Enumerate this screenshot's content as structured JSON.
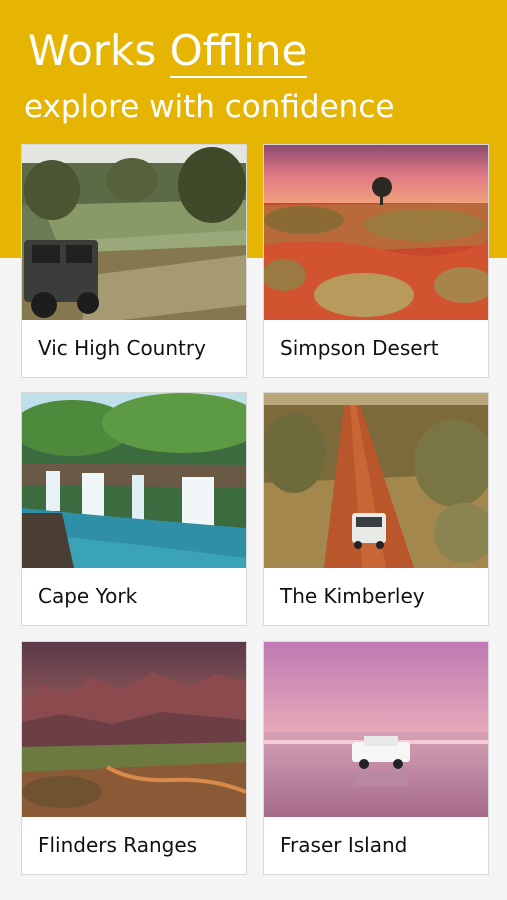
{
  "header": {
    "headline_pre": "Works ",
    "headline_emph": "Offline",
    "tagline": "explore with confidence"
  },
  "regions": [
    {
      "name": "Vic High Country"
    },
    {
      "name": "Simpson Desert"
    },
    {
      "name": "Cape York"
    },
    {
      "name": "The Kimberley"
    },
    {
      "name": "Flinders Ranges"
    },
    {
      "name": "Fraser Island"
    }
  ]
}
